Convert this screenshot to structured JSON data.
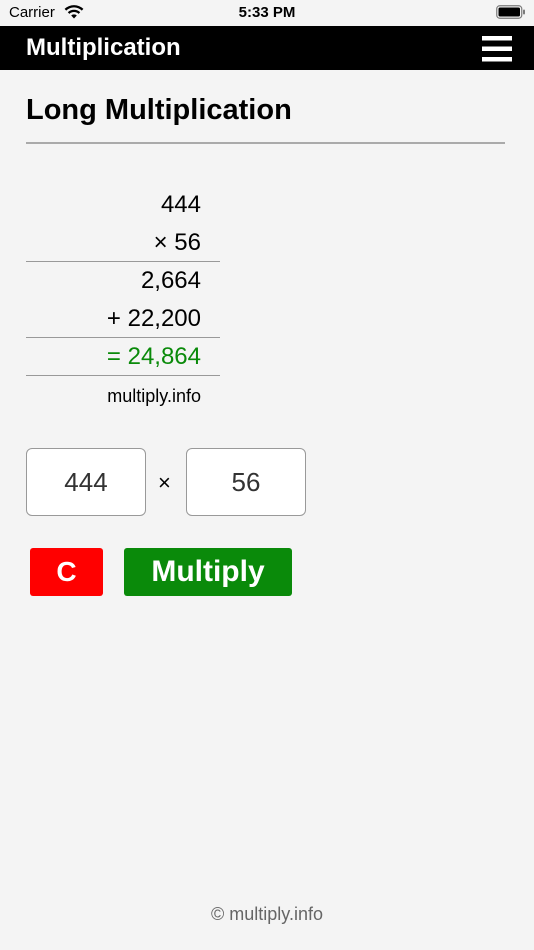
{
  "status_bar": {
    "carrier": "Carrier",
    "time": "5:33 PM",
    "wifi_icon": "wifi-icon",
    "battery_icon": "battery-icon"
  },
  "nav": {
    "title": "Multiplication",
    "menu_icon": "hamburger-menu-icon"
  },
  "page": {
    "title": "Long Multiplication"
  },
  "calculation": {
    "multiplicand": "444",
    "multiplier_line": "× 56",
    "partial_1": "2,664",
    "partial_2_line": "+ 22,200",
    "result_line": "= 24,864",
    "credit": "multiply.info"
  },
  "inputs": {
    "first_value": "444",
    "times_symbol": "×",
    "second_value": "56"
  },
  "buttons": {
    "clear_label": "C",
    "multiply_label": "Multiply"
  },
  "footer": {
    "text": "© multiply.info"
  },
  "colors": {
    "nav_background": "#000000",
    "clear_button": "#ff0000",
    "multiply_button": "#0a8a0a",
    "result_text": "#0a8a0a"
  }
}
